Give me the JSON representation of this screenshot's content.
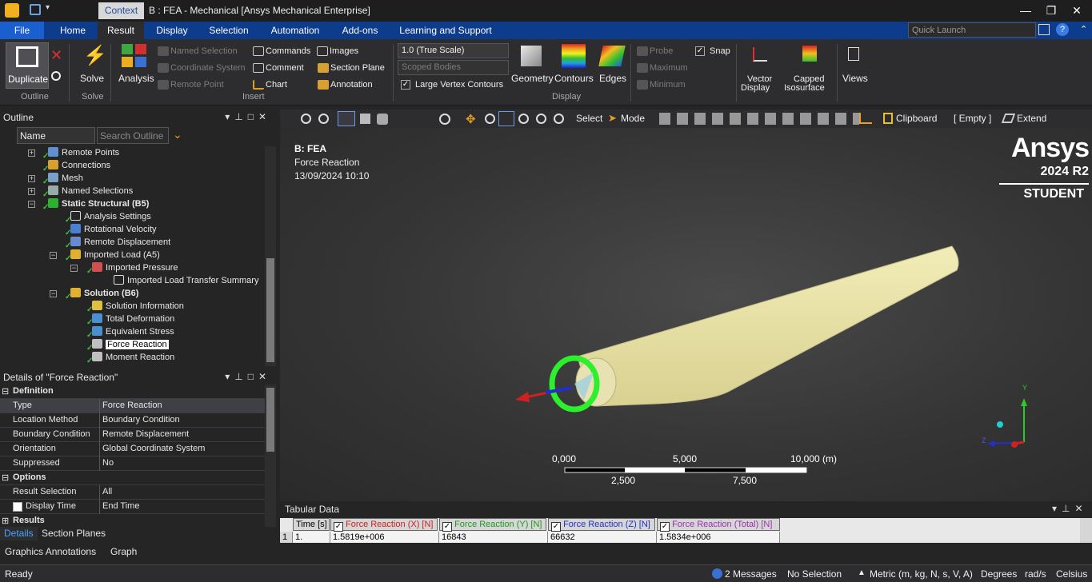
{
  "window": {
    "context_tab": "Context",
    "title": "B : FEA - Mechanical [Ansys Mechanical Enterprise]"
  },
  "tabs": [
    "File",
    "Home",
    "Result",
    "Display",
    "Selection",
    "Automation",
    "Add-ons",
    "Learning and Support"
  ],
  "active_tab": "Result",
  "quick_launch_placeholder": "Quick Launch",
  "ribbon": {
    "duplicate": "Duplicate",
    "solve": "Solve",
    "analysis": "Analysis",
    "named_selection": "Named Selection",
    "coordinate_system": "Coordinate System",
    "remote_point": "Remote Point",
    "commands": "Commands",
    "comment": "Comment",
    "chart": "Chart",
    "images": "Images",
    "section_plane": "Section Plane",
    "annotation": "Annotation",
    "scale": "1.0 (True Scale)",
    "scoped_bodies": "Scoped Bodies",
    "large_vertex_contours": "Large Vertex Contours",
    "geometry": "Geometry",
    "contours": "Contours",
    "edges": "Edges",
    "probe": "Probe",
    "maximum": "Maximum",
    "minimum": "Minimum",
    "snap": "Snap",
    "vector_display_1": "Vector",
    "vector_display_2": "Display",
    "capped_isosurface_1": "Capped",
    "capped_isosurface_2": "Isosurface",
    "views": "Views",
    "groups": {
      "outline": "Outline",
      "solve": "Solve",
      "insert": "Insert",
      "display": "Display"
    }
  },
  "outline": {
    "title": "Outline",
    "name_filter": "Name",
    "search_placeholder": "Search Outline",
    "nodes": [
      {
        "label": "Remote Points"
      },
      {
        "label": "Connections"
      },
      {
        "label": "Mesh"
      },
      {
        "label": "Named Selections"
      },
      {
        "label": "Static Structural (B5)"
      },
      {
        "label": "Analysis Settings"
      },
      {
        "label": "Rotational Velocity"
      },
      {
        "label": "Remote Displacement"
      },
      {
        "label": "Imported Load (A5)"
      },
      {
        "label": "Imported Pressure"
      },
      {
        "label": "Imported Load Transfer Summary"
      },
      {
        "label": "Solution (B6)"
      },
      {
        "label": "Solution Information"
      },
      {
        "label": "Total Deformation"
      },
      {
        "label": "Equivalent Stress"
      },
      {
        "label": "Force Reaction"
      },
      {
        "label": "Moment Reaction"
      }
    ]
  },
  "details": {
    "title": "Details of \"Force Reaction\"",
    "sections": {
      "definition": "Definition",
      "options": "Options",
      "results": "Results"
    },
    "rows": [
      {
        "k": "Type",
        "v": "Force Reaction"
      },
      {
        "k": "Location Method",
        "v": "Boundary Condition"
      },
      {
        "k": "Boundary Condition",
        "v": "Remote Displacement"
      },
      {
        "k": "Orientation",
        "v": "Global Coordinate System"
      },
      {
        "k": "Suppressed",
        "v": "No"
      },
      {
        "k": "Result Selection",
        "v": "All"
      },
      {
        "k": "Display Time",
        "v": "End Time"
      }
    ],
    "tab_details": "Details",
    "tab_section_planes": "Section Planes",
    "tab_graphics_annotations": "Graphics Annotations",
    "tab_graph": "Graph"
  },
  "viewport_toolbar": {
    "select": "Select",
    "mode": "Mode",
    "clipboard": "Clipboard",
    "empty": "[ Empty ]",
    "extend": "Extend"
  },
  "viewport": {
    "model": "B: FEA",
    "result": "Force Reaction",
    "datetime": "13/09/2024 10:10",
    "brand": "Ansys",
    "version": "2024 R2",
    "edition": "STUDENT",
    "scale_top": [
      "0,000",
      "5,000",
      "10,000 (m)"
    ],
    "scale_bottom": [
      "2,500",
      "7,500"
    ],
    "axis_y": "Y",
    "axis_z": "Z"
  },
  "tabular": {
    "title": "Tabular Data",
    "columns": [
      "Time [s]",
      "Force Reaction (X) [N]",
      "Force Reaction (Y) [N]",
      "Force Reaction (Z) [N]",
      "Force Reaction (Total) [N]"
    ],
    "row_index": "1",
    "row": [
      "1.",
      "1.5819e+006",
      "16843",
      "66632",
      "1.5834e+006"
    ],
    "colors": {
      "x": "#d02020",
      "y": "#1c9a1c",
      "z": "#2030c8",
      "total": "#9c30b0"
    }
  },
  "status": {
    "ready": "Ready",
    "messages": "2 Messages",
    "selection": "No Selection",
    "units": "Metric (m, kg, N, s, V, A)",
    "angle": "Degrees",
    "rot": "rad/s",
    "temp": "Celsius"
  }
}
